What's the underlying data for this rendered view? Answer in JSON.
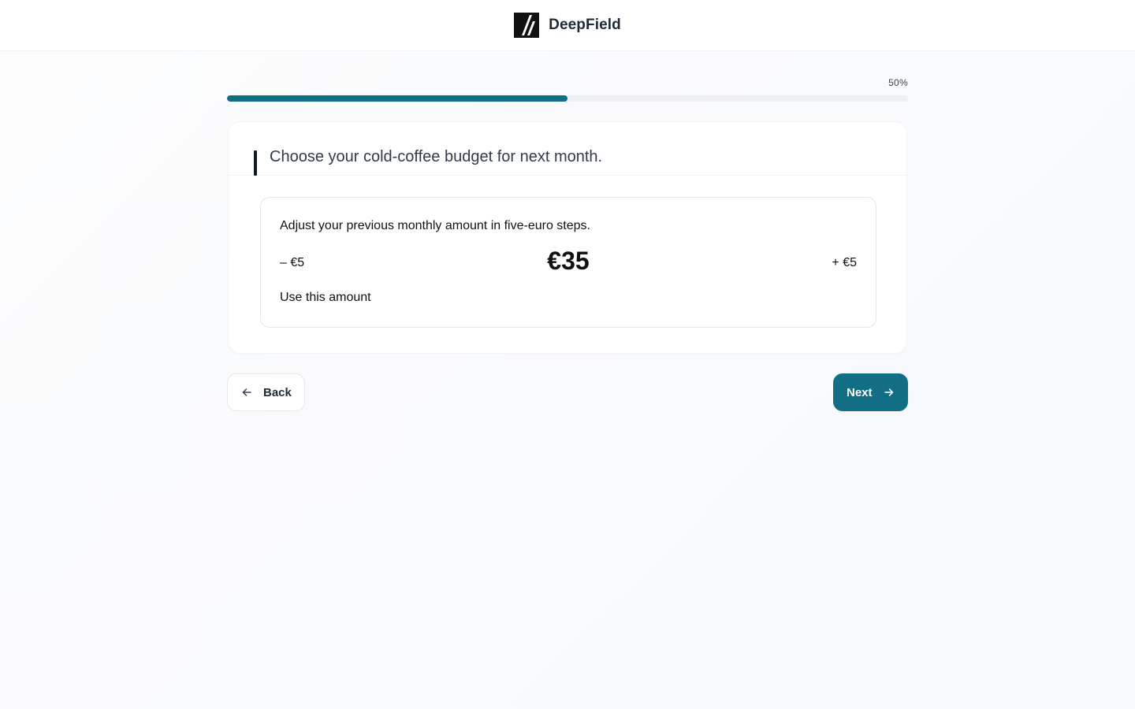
{
  "header": {
    "brand_name": "DeepField",
    "logo_icon": "deepfield-logo"
  },
  "progress": {
    "label": "50%",
    "fraction": 0.5
  },
  "question": {
    "title": "Choose your cold-coffee budget for next month."
  },
  "stepper": {
    "description": "Adjust your previous monthly amount in five-euro steps.",
    "decrement_label": "– €5",
    "increment_label": "+ €5",
    "amount": "€35",
    "confirm_label": "Use this amount"
  },
  "navigation": {
    "back_label": "Back",
    "back_icon": "arrow-left-icon",
    "next_label": "Next",
    "next_icon": "arrow-right-icon"
  },
  "colors": {
    "accent": "#126e85",
    "track": "#eceff3",
    "text": "#111827"
  }
}
